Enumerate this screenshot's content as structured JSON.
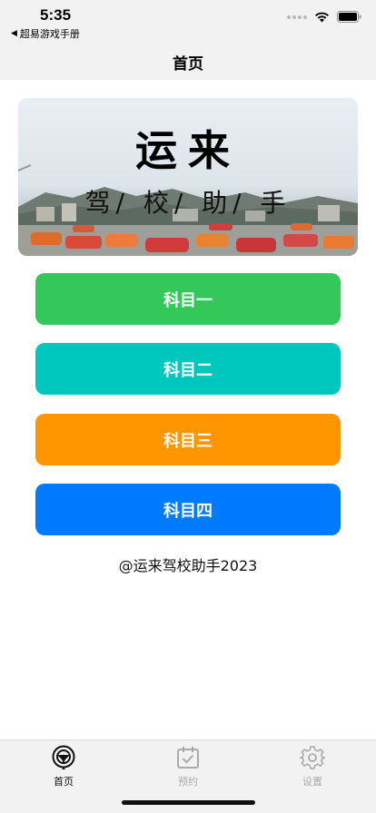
{
  "status_bar": {
    "time": "5:35",
    "back_app": "超易游戏手册"
  },
  "nav": {
    "title": "首页"
  },
  "banner": {
    "title": "运来",
    "subtitle": "驾/ 校/ 助/ 手"
  },
  "subjects": [
    {
      "label": "科目一",
      "color": "#34c759"
    },
    {
      "label": "科目二",
      "color": "#00c7be"
    },
    {
      "label": "科目三",
      "color": "#ff9500"
    },
    {
      "label": "科目四",
      "color": "#007aff"
    }
  ],
  "footer_credit": "@运来驾校助手2023",
  "tabs": [
    {
      "label": "首页",
      "icon": "steering-wheel-icon",
      "active": true
    },
    {
      "label": "预约",
      "icon": "calendar-check-icon",
      "active": false
    },
    {
      "label": "设置",
      "icon": "gear-icon",
      "active": false
    }
  ],
  "colors": {
    "tab_active": "#111111",
    "tab_inactive": "#aaaaaa"
  }
}
